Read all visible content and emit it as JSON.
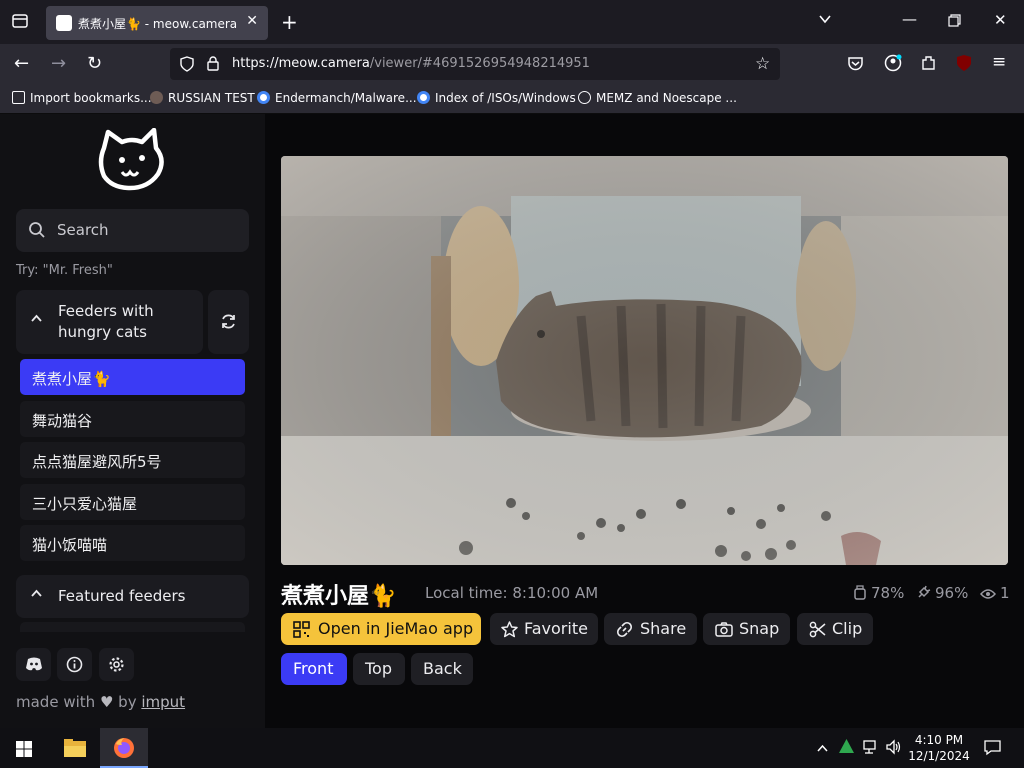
{
  "browser": {
    "tab_title": "煮煮小屋🐈 - meow.camera",
    "url_host": "https://meow.camera",
    "url_path": "/viewer/#4691526954948214951",
    "bookmarks": [
      "Import bookmarks...",
      "RUSSIAN TEST",
      "Endermanch/Malware...",
      "Index of /ISOs/Windows",
      "MEMZ and Noescape ..."
    ]
  },
  "sidebar": {
    "search_placeholder": "Search",
    "try_hint": "Try: \"Mr. Fresh\"",
    "group_hungry_label_line1": "Feeders with",
    "group_hungry_label_line2": "hungry cats",
    "feeders": [
      "煮煮小屋🐈",
      "舞动猫谷",
      "点点猫屋避风所5号",
      "三小只爱心猫屋",
      "猫小饭喵喵"
    ],
    "group_featured_label": "Featured feeders",
    "made_with_prefix": "made with",
    "made_with_heart": "♥",
    "made_with_by": "by",
    "made_with_author": "imput"
  },
  "viewer": {
    "feeder_name": "煮煮小屋🐈",
    "local_time": "Local time: 8:10:00 AM",
    "food_level": "78%",
    "battery_level": "96%",
    "viewers": "1",
    "buttons": {
      "open_app": "Open in JieMao app",
      "favorite": "Favorite",
      "share": "Share",
      "snap": "Snap",
      "clip": "Clip"
    },
    "cameras": [
      "Front",
      "Top",
      "Back"
    ],
    "active_camera": "Front"
  },
  "taskbar": {
    "time": "4:10 PM",
    "date": "12/1/2024"
  },
  "colors": {
    "accent_blue": "#3b3bf5",
    "accent_yellow": "#f5c33b"
  }
}
